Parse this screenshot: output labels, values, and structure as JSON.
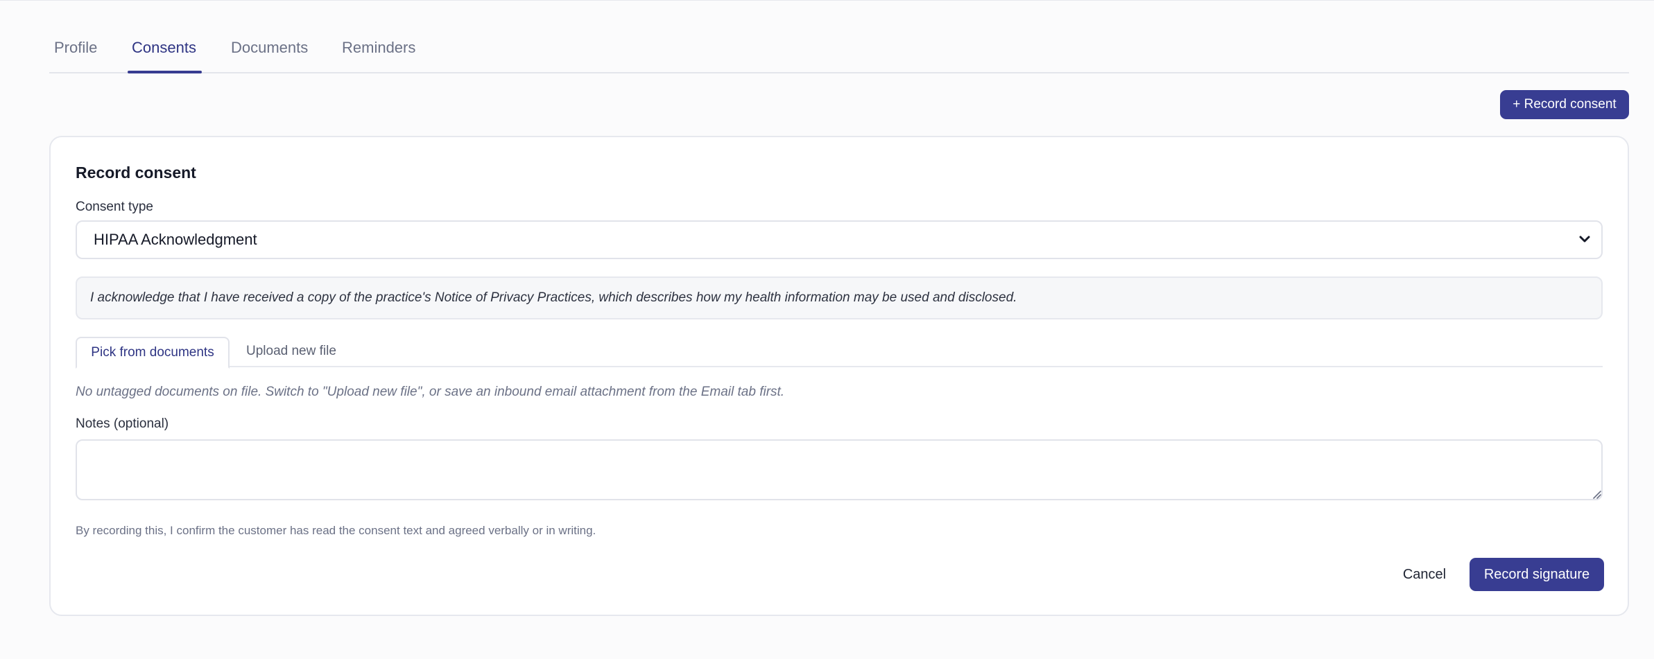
{
  "tabs": [
    {
      "label": "Profile"
    },
    {
      "label": "Consents"
    },
    {
      "label": "Documents"
    },
    {
      "label": "Reminders"
    }
  ],
  "header": {
    "add_button_label": "+ Record consent"
  },
  "form": {
    "title": "Record consent",
    "consent_type_label": "Consent type",
    "consent_type_value": "HIPAA Acknowledgment",
    "consent_text": "I acknowledge that I have received a copy of the practice's Notice of Privacy Practices, which describes how my health information may be used and disclosed.",
    "source_tabs": [
      {
        "label": "Pick from documents"
      },
      {
        "label": "Upload new file"
      }
    ],
    "empty_documents_note": "No untagged documents on file. Switch to \"Upload new file\", or save an inbound email attachment from the Email tab first.",
    "notes_label": "Notes (optional)",
    "notes_value": "",
    "disclaimer": "By recording this, I confirm the customer has read the consent text and agreed verbally or in writing.",
    "cancel_label": "Cancel",
    "submit_label": "Record signature"
  },
  "colors": {
    "accent": "#383d92",
    "active_tab_text": "#2e3483",
    "border": "#e6e8ee"
  }
}
